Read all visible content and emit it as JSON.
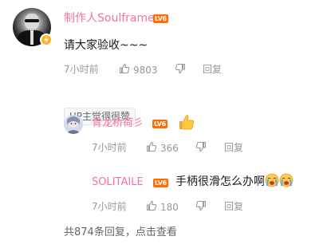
{
  "comment": {
    "username": "制作人Soulframe",
    "username_color": "#fb7299",
    "level": "LV6",
    "level_color": "#ff6c00",
    "text": "请大家验收~~~",
    "time": "7小时前",
    "likes": "9803",
    "reply_label": "回复",
    "up_tag": "UP主觉得很赞"
  },
  "replies": [
    {
      "username": "青龙桥荷彡",
      "username_color": "#fb7299",
      "level": "LV6",
      "level_color": "#ff6c00",
      "text": "",
      "emoji": "thumbs-up",
      "time": "7小时前",
      "likes": "366",
      "reply_label": "回复"
    },
    {
      "username": "SOLITAILE",
      "username_color": "#fb7299",
      "level": "LV6",
      "level_color": "#ff6c00",
      "text": "手柄很滑怎么办啊",
      "emoji": "crying-face",
      "time": "7小时前",
      "likes": "180",
      "reply_label": "回复"
    }
  ],
  "footer": {
    "more_replies": "共874条回复，点击查看"
  }
}
